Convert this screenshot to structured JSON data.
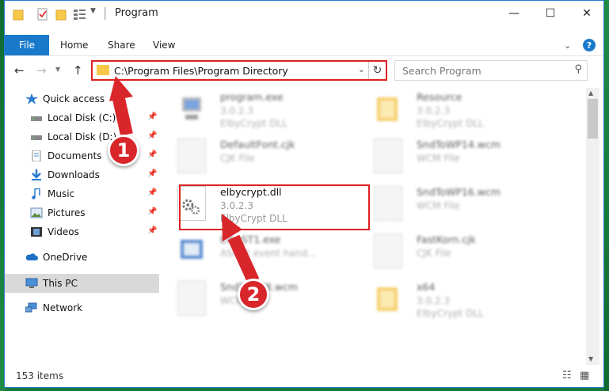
{
  "window": {
    "title": "Program",
    "controls": {
      "minimize": "—",
      "maximize": "☐",
      "close": "✕"
    }
  },
  "ribbon": {
    "file": "File",
    "tabs": [
      "Home",
      "Share",
      "View"
    ],
    "help": "?"
  },
  "nav": {
    "address": "C:\\Program Files\\Program Directory",
    "search_placeholder": "Search Program"
  },
  "sidebar": {
    "items": [
      {
        "label": "Quick access",
        "icon": "star-icon"
      },
      {
        "label": "Local Disk (C:)",
        "icon": "drive-icon",
        "pinned": true
      },
      {
        "label": "Local Disk (D:)",
        "icon": "drive-icon",
        "pinned": true
      },
      {
        "label": "Documents",
        "icon": "documents-icon",
        "pinned": true
      },
      {
        "label": "Downloads",
        "icon": "download-icon",
        "pinned": true
      },
      {
        "label": "Music",
        "icon": "music-icon",
        "pinned": true
      },
      {
        "label": "Pictures",
        "icon": "pictures-icon",
        "pinned": true
      },
      {
        "label": "Videos",
        "icon": "videos-icon",
        "pinned": true
      },
      {
        "label": "OneDrive",
        "icon": "cloud-icon"
      },
      {
        "label": "This PC",
        "icon": "computer-icon",
        "selected": true
      },
      {
        "label": "Network",
        "icon": "network-icon"
      }
    ]
  },
  "files": [
    {
      "name": "program.exe",
      "line2": "3.0.2.3",
      "line3": "ElbyCrypt DLL",
      "blurred": true,
      "icon": "exe-icon"
    },
    {
      "name": "Resource",
      "line2": "3.0.2.3",
      "line3": "ElbyCrypt DLL",
      "blurred": true,
      "icon": "folder-icon"
    },
    {
      "name": "DefaultFont.cjk",
      "line2": "CJK File",
      "line3": "",
      "blurred": true,
      "icon": "file-icon"
    },
    {
      "name": "SndToWP14.wcm",
      "line2": "WCM File",
      "line3": "",
      "blurred": true,
      "icon": "file-icon"
    },
    {
      "name": "elbycrypt.dll",
      "line2": "3.0.2.3",
      "line3": "ElbyCrypt DLL",
      "blurred": false,
      "icon": "dll-gear-icon"
    },
    {
      "name": "SndToWP16.wcm",
      "line2": "WCM File",
      "line3": "",
      "blurred": true,
      "icon": "file-icon"
    },
    {
      "name": "ElbyST1.exe",
      "line2": "ASP st event hand...",
      "line3": "",
      "blurred": true,
      "icon": "exe-icon"
    },
    {
      "name": "FastKorn.cjk",
      "line2": "CJK File",
      "line3": "",
      "blurred": true,
      "icon": "file-icon"
    },
    {
      "name": "SndToWP8.wcm",
      "line2": "WCM File",
      "line3": "",
      "blurred": true,
      "icon": "file-icon"
    },
    {
      "name": "x64",
      "line2": "3.0.2.3",
      "line3": "ElbyCrypt DLL",
      "blurred": true,
      "icon": "folder-icon"
    }
  ],
  "status": {
    "count": "153 items"
  },
  "annotations": {
    "step1": "1",
    "step2": "2"
  },
  "colors": {
    "accent": "#1979ca",
    "highlight": "#dd2222",
    "badge": "#d8262b"
  }
}
